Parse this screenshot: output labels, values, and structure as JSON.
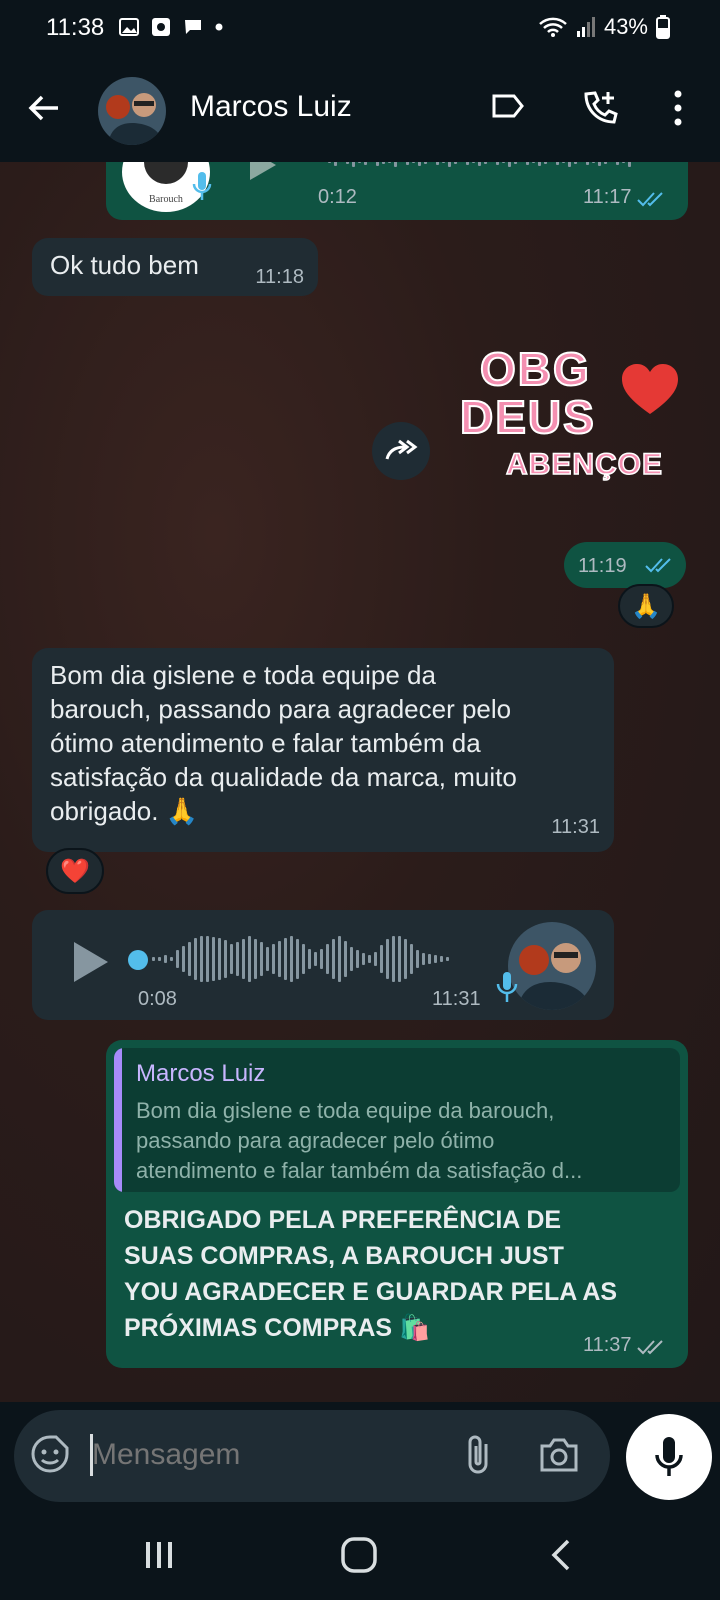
{
  "status_bar": {
    "time": "11:38",
    "battery": "43%"
  },
  "header": {
    "contact_name": "Marcos Luiz",
    "icons": [
      "back-arrow-icon",
      "label-icon",
      "add-call-icon",
      "more-vert-icon"
    ]
  },
  "messages": {
    "voice_top": {
      "duration": "0:12",
      "time": "11:17"
    },
    "msg1": {
      "text": "Ok tudo bem",
      "time": "11:18"
    },
    "sticker": {
      "line1": "OBG",
      "line2": "DEUS",
      "line3": "ABENÇOE",
      "time": "11:19",
      "reaction": "🙏"
    },
    "msg2": {
      "lines": [
        "Bom dia gislene e toda equipe da",
        "barouch, passando para agradecer pelo",
        "ótimo atendimento e falar também da",
        "satisfação da qualidade da marca, muito",
        "obrigado. 🙏"
      ],
      "time": "11:31",
      "reaction": "❤️"
    },
    "voice_in": {
      "duration": "0:08",
      "time": "11:31"
    },
    "reply": {
      "quoted_name": "Marcos Luiz",
      "quoted_lines": [
        "Bom dia gislene e toda equipe da barouch,",
        "passando para agradecer pelo ótimo",
        "atendimento e falar também da satisfação d..."
      ],
      "lines": [
        "OBRIGADO PELA PREFERÊNCIA DE",
        "SUAS COMPRAS,  A BAROUCH JUST",
        "YOU AGRADECER E GUARDAR PELA AS",
        "PRÓXIMAS COMPRAS 🛍️"
      ],
      "time": "11:37"
    }
  },
  "composer": {
    "placeholder": "Mensagem"
  },
  "colors": {
    "incoming": "#202c33",
    "outgoing": "#0f5342",
    "tick_read": "#53bdeb",
    "quote_bar": "#a78bfa",
    "sticker_pink": "#f48fb1",
    "heart": "#e53935"
  }
}
